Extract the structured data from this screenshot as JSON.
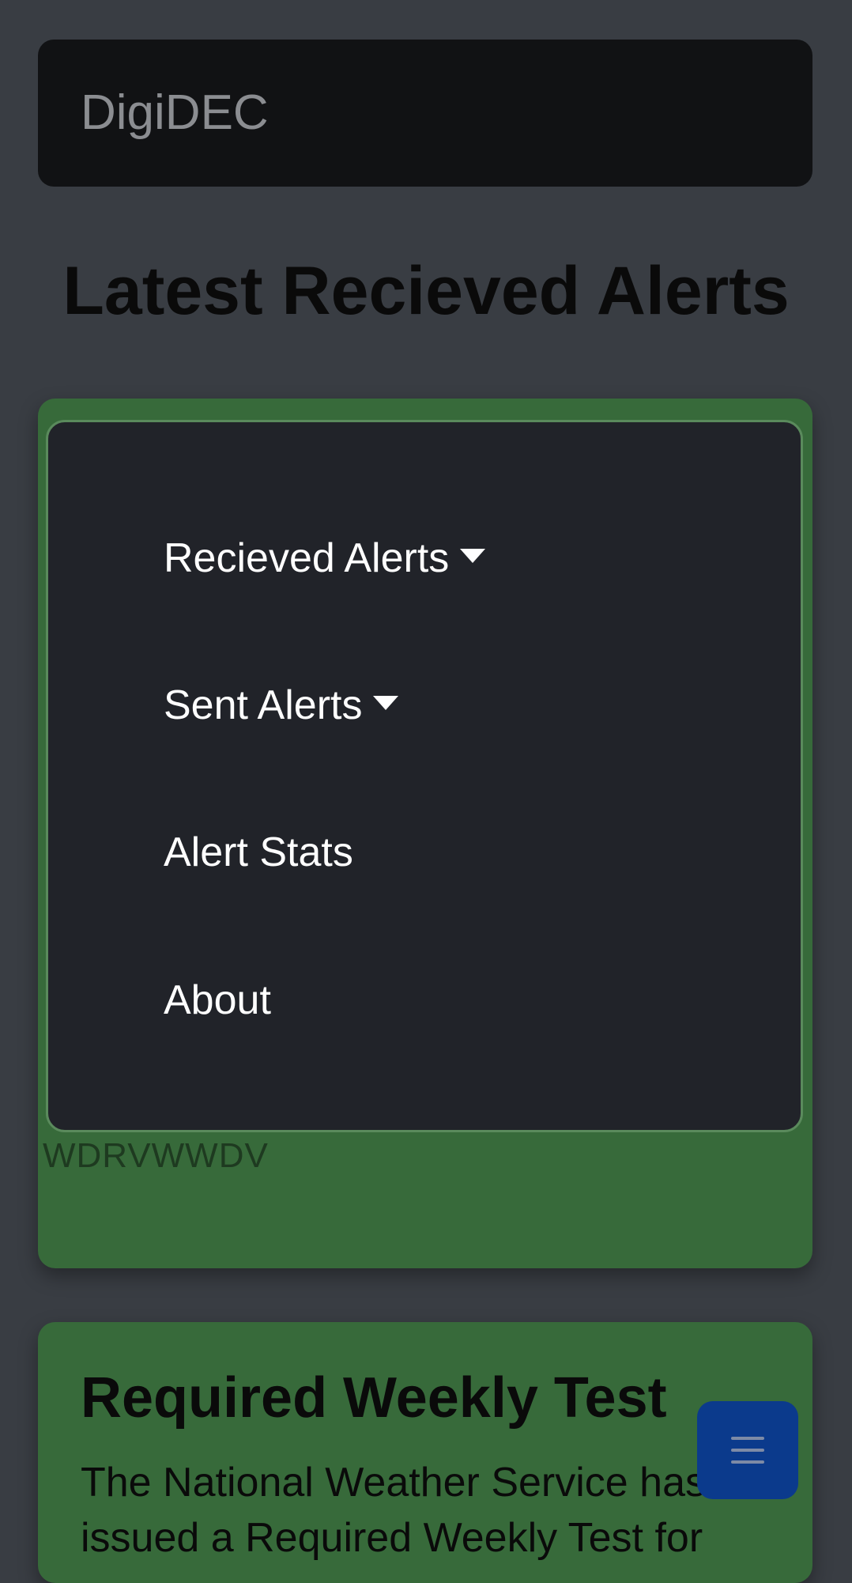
{
  "navbar": {
    "brand": "DigiDEC"
  },
  "page": {
    "title": "Latest Recieved Alerts"
  },
  "menu": {
    "items": [
      {
        "label": "Recieved Alerts",
        "has_dropdown": true
      },
      {
        "label": "Sent Alerts",
        "has_dropdown": true
      },
      {
        "label": "Alert Stats",
        "has_dropdown": false
      },
      {
        "label": "About",
        "has_dropdown": false
      }
    ]
  },
  "alerts": [
    {
      "subtitle": "WDRVWWDV"
    },
    {
      "title": "Required Weekly Test",
      "body": "The National Weather Service has issued a Required Weekly Test for"
    }
  ],
  "fab": {
    "icon": "hamburger-menu-icon"
  },
  "colors": {
    "background": "#393d43",
    "navbar": "#111214",
    "card": "#376a3a",
    "menu_panel": "#212329",
    "fab": "#0b3a8c"
  }
}
